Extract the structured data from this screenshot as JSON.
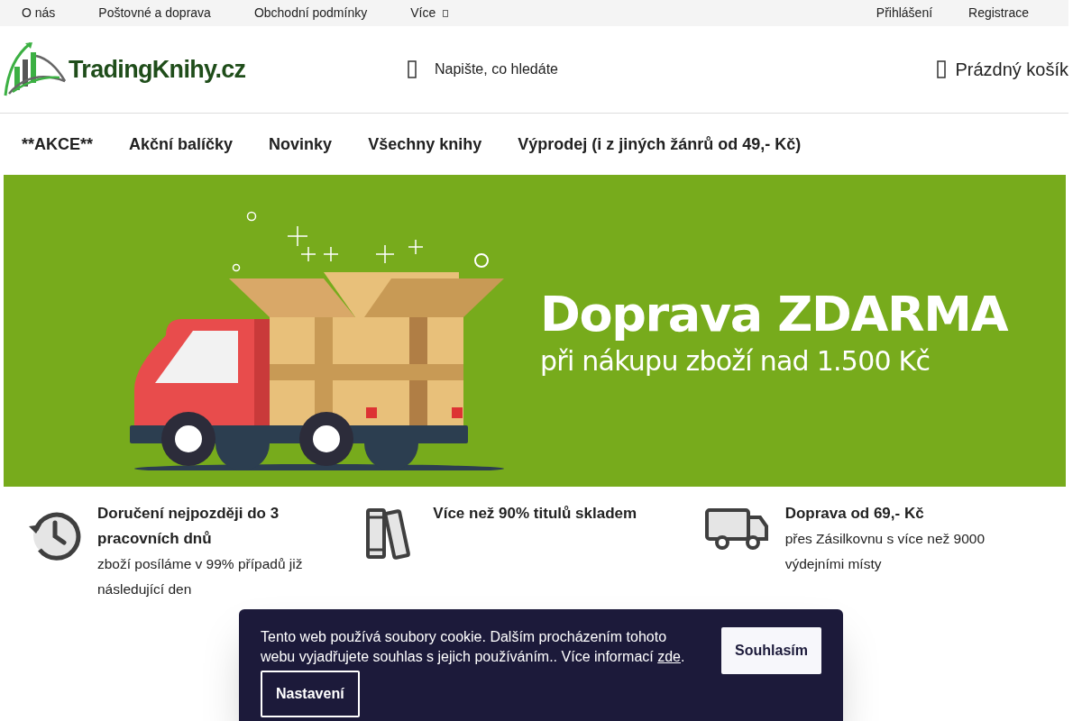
{
  "top_bar": {
    "links": [
      {
        "label": "O nás",
        "has_menu": false
      },
      {
        "label": "Poštovné a doprava",
        "has_menu": false
      },
      {
        "label": "Obchodní podmínky",
        "has_menu": false
      },
      {
        "label": "Více",
        "has_menu": true
      }
    ],
    "account_links": [
      "Přihlášení",
      "Registrace"
    ]
  },
  "header": {
    "logo": "TradingKnihy.cz",
    "search": {
      "placeholder": "Napište, co hledáte"
    },
    "cart": "Prázdný košík"
  },
  "menu": [
    "**AKCE**",
    "Akční balíčky",
    "Novinky",
    "Všechny knihy",
    "Výprodej (i z jiných žánrů od 49,- Kč)"
  ],
  "banner": {
    "headline": "Doprava ZDARMA",
    "subline": "při nákupu zboží nad 1.500 Kč"
  },
  "benefits": [
    {
      "kind": "clock",
      "title": "Doručení nejpozději do 3 pracovních dnů",
      "text": "zboží posíláme v 99% případů již následující den"
    },
    {
      "kind": "books",
      "title": "Více než 90% titulů skladem"
    },
    {
      "kind": "truck",
      "title": "Doprava od 69,- Kč",
      "text": "přes Zásilkovnu s více než 9000 výdejními místy"
    }
  ],
  "cookie": {
    "text": "Tento web používá soubory cookie. Dalším procházením tohoto webu vyjadřujete souhlas s jejich používáním.. Více informací",
    "link": "zde",
    "after": ".",
    "accept": "Souhlasím",
    "settings": "Nastavení"
  }
}
